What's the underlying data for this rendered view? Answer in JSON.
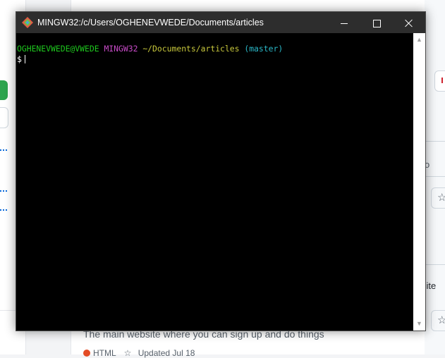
{
  "window": {
    "title": "MINGW32:/c/Users/OGHENEVWEDE/Documents/articles",
    "controls": {
      "minimize": "Minimize",
      "maximize": "Maximize",
      "close": "Close"
    }
  },
  "terminal": {
    "prompt": {
      "user_host": "OGHENEVWEDE@VWEDE",
      "system": "MINGW32",
      "path": "~/Documents/articles",
      "branch": "(master)"
    },
    "input_symbol": "$"
  },
  "background": {
    "repo_description": "The main website where you can sign up and do things",
    "repo_language": "HTML",
    "repo_updated": "Updated Jul 18",
    "snippet_right_1": "o",
    "snippet_right_2": "site"
  },
  "colors": {
    "prompt_user": "#1ec81e",
    "prompt_system": "#c84bc8",
    "prompt_path": "#c8c83c",
    "prompt_branch": "#2ab8c8",
    "titlebar": "#2d2d2d",
    "terminal_bg": "#000000"
  },
  "icons": {
    "app": "git-bash-icon",
    "star": "star-icon"
  }
}
